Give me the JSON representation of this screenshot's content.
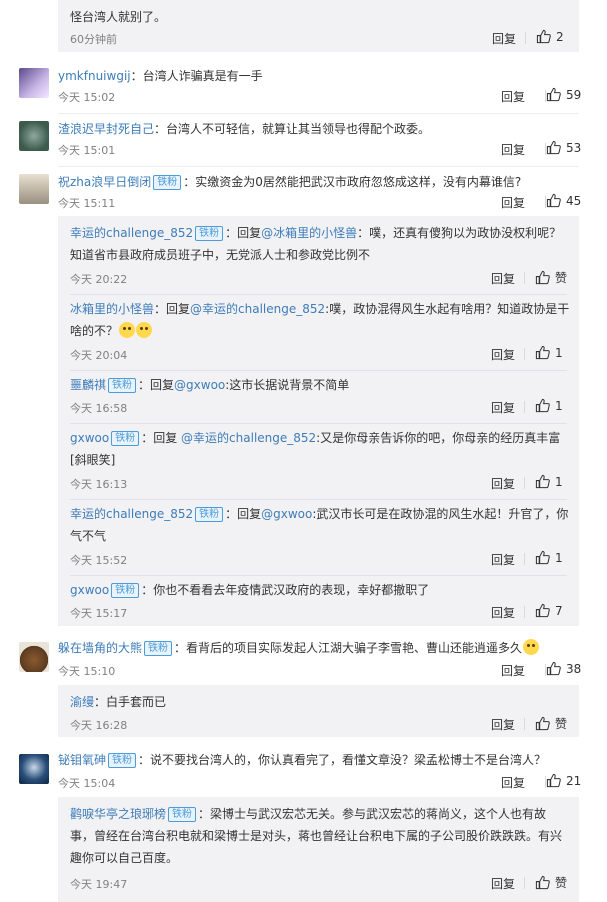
{
  "top": {
    "text": "怪台湾人就别了。",
    "time": "60分钟前",
    "reply": "回复",
    "likes": "2"
  },
  "comments": [
    {
      "user": "ymkfnuiwgij",
      "badge": "",
      "text": "：台湾人诈骗真是有一手",
      "time": "今天 15:02",
      "reply": "回复",
      "likes": "59"
    },
    {
      "user": "渣浪迟早封死自己",
      "badge": "",
      "text": "：台湾人不可轻信，就算让其当领导也得配个政委。",
      "time": "今天 15:01",
      "reply": "回复",
      "likes": "53"
    },
    {
      "user": "祝zha浪早日倒闭",
      "badge": "铁粉",
      "text": "：实缴资金为0居然能把武汉市政府忽悠成这样，没有内幕谁信?",
      "time": "今天 15:11",
      "reply": "回复",
      "likes": "45"
    },
    {
      "user": "躲在墙角的大熊",
      "badge": "铁粉",
      "text": "：看背后的项目实际发起人江湖大骗子李雪艳、曹山还能逍遥多久",
      "time": "今天 15:10",
      "reply": "回复",
      "likes": "38"
    },
    {
      "user": "铋钼氧砷",
      "badge": "铁粉",
      "text": "：说不要找台湾人的，你认真看完了，看懂文章没？梁孟松博士不是台湾人？",
      "time": "今天 15:04",
      "reply": "回复",
      "likes": "21"
    }
  ],
  "replies_a": [
    {
      "user": "幸运的challenge_852",
      "badge": "铁粉",
      "prefix": "：回复",
      "at": "@冰箱里的小怪兽",
      "text": "：噗，还真有傻狗以为政协没权利呢？知道省市县政府成员班子中，无党派人士和参政党比例不",
      "time": "今天 20:22",
      "reply": "回复",
      "likes": "赞"
    },
    {
      "user": "冰箱里的小怪兽",
      "badge": "",
      "prefix": "：回复",
      "at": "@幸运的challenge_852",
      "text": ":噗，政协混得风生水起有啥用？知道政协是干啥的不？",
      "time": "今天 20:04",
      "reply": "回复",
      "likes": "1"
    },
    {
      "user": "噩麟祺",
      "badge": "铁粉",
      "prefix": "：回复",
      "at": "@gxwoo",
      "text": ":这市长据说背景不简单",
      "time": "今天 16:58",
      "reply": "回复",
      "likes": "1"
    },
    {
      "user": "gxwoo",
      "badge": "铁粉",
      "prefix": "：回复 ",
      "at": "@幸运的challenge_852",
      "text": ":又是你母亲告诉你的吧，你母亲的经历真丰富[斜眼笑]",
      "time": "今天 16:13",
      "reply": "回复",
      "likes": "1"
    },
    {
      "user": "幸运的challenge_852",
      "badge": "铁粉",
      "prefix": "：回复",
      "at": "@gxwoo",
      "text": ":武汉市长可是在政协混的风生水起！升官了，你气不气",
      "time": "今天 15:52",
      "reply": "回复",
      "likes": "1"
    },
    {
      "user": "gxwoo",
      "badge": "铁粉",
      "prefix": "",
      "at": "",
      "text": "：你也不看看去年疫情武汉政府的表现，幸好都撤职了",
      "time": "今天 15:17",
      "reply": "回复",
      "likes": "7"
    }
  ],
  "replies_b": [
    {
      "user": "渝缦",
      "badge": "",
      "text": "：白手套而已",
      "time": "今天 16:28",
      "reply": "回复",
      "likes": "赞"
    }
  ],
  "replies_c": [
    {
      "user": "鹳唳华亭之琅琊榜",
      "badge": "铁粉",
      "text": "：梁博士与武汉宏芯无关。参与武汉宏芯的蒋尚义，这个人也有故事，曾经在台湾台积电就和梁博士是对头，蒋也曾经让台积电下属的子公司股价跌跌跌。有兴趣你可以自己百度。",
      "time": "今天 19:47",
      "reply": "回复",
      "likes": "赞"
    }
  ]
}
